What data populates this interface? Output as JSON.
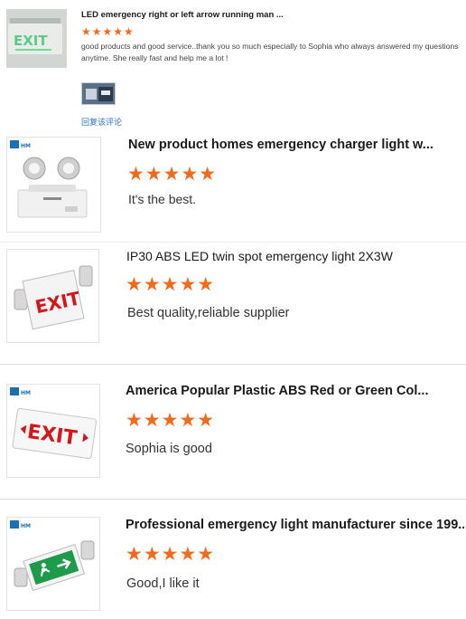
{
  "reviews": [
    {
      "title": "LED emergency right or left arrow running man ...",
      "rating": 5,
      "stars": "★★★★★",
      "comment": "good products and good service..thank you so much especially to Sophia who always answered my questions anytime. She really fast and help me a lot !",
      "reply_link": "回复该评论",
      "attachment_icon": "photo-thumbnail-icon"
    },
    {
      "title": "New product homes emergency charger light w...",
      "rating": 5,
      "stars": "★★★★★",
      "comment": "It's the best.",
      "brand_logo": "HM"
    },
    {
      "title": "IP30 ABS LED twin spot emergency light 2X3W",
      "rating": 5,
      "stars": "★★★★★",
      "comment": "Best quality,reliable supplier",
      "sign_text": "EXIT"
    },
    {
      "title": "America Popular Plastic ABS Red or Green Col...",
      "rating": 5,
      "stars": "★★★★★",
      "comment": "Sophia is good",
      "brand_logo": "HM",
      "sign_text": "EXIT"
    },
    {
      "title": "Professional emergency light manufacturer since 199...",
      "rating": 5,
      "stars": "★★★★★",
      "comment": "Good,I like it",
      "brand_logo": "HM"
    }
  ],
  "colors": {
    "star": "#f26a1b",
    "link": "#2a76c6",
    "exit_red": "#d4161b",
    "exit_green": "#1d9a4a"
  }
}
